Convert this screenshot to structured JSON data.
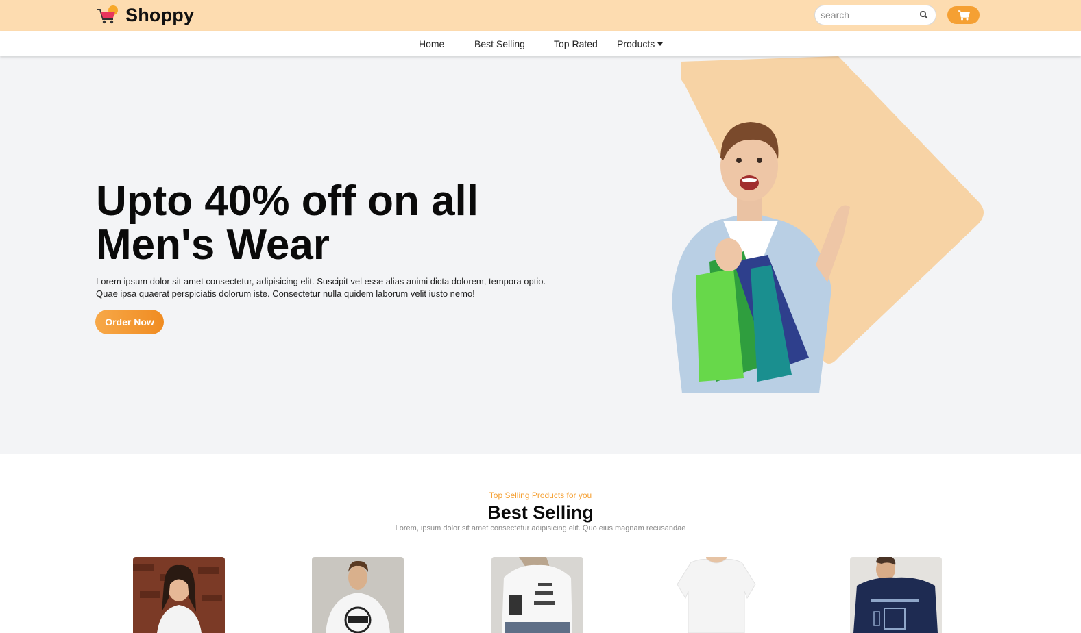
{
  "brand": {
    "name": "Shoppy"
  },
  "search": {
    "placeholder": "search"
  },
  "nav": {
    "items": [
      {
        "label": "Home"
      },
      {
        "label": "Best Selling"
      },
      {
        "label": "Top Rated"
      },
      {
        "label": "Products"
      }
    ]
  },
  "hero": {
    "title_line1": "Upto 40% off on all",
    "title_line2": "Men's Wear",
    "description": "Lorem ipsum dolor sit amet consectetur, adipisicing elit. Suscipit vel esse alias animi dicta dolorem, tempora optio. Quae ipsa quaerat perspiciatis dolorum iste. Consectetur nulla quidem laborum velit iusto nemo!",
    "cta_label": "Order Now"
  },
  "best_selling": {
    "subtitle": "Top Selling Products for you",
    "title": "Best Selling",
    "description": "Lorem, ipsum dolor sit amet consectetur adipisicing elit. Quo eius magnam recusandae",
    "products": [
      {
        "image": "woman-white-shirt"
      },
      {
        "image": "man-legendary-tee"
      },
      {
        "image": "woman-no-one-cares-tee"
      },
      {
        "image": "plain-white-tee"
      },
      {
        "image": "man-navy-print-tee"
      }
    ]
  },
  "colors": {
    "topbar": "#fddcb0",
    "accent": "#f5a033",
    "hero_bg": "#f3f4f6",
    "diamond": "#f7d3a5"
  }
}
